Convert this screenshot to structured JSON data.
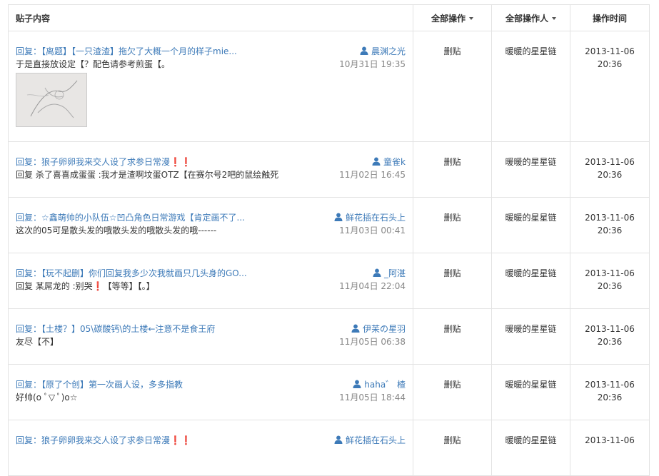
{
  "header": {
    "content": "贴子内容",
    "operation": "全部操作",
    "operator": "全部操作人",
    "time": "操作时间"
  },
  "rows": [
    {
      "title": "回复：【离题】【一只渣渣】拖欠了大概一个月的样子mie...",
      "text": "于是直接放设定【？配色请参考煎蛋【。",
      "author": "晨渊之光",
      "date": "10月31日 19:35",
      "operation": "删贴",
      "operator": "暖暖的星星链",
      "op_date": "2013-11-06",
      "op_time": "20:36",
      "has_image": true
    },
    {
      "title": "回复：狼子卵卵我来交人设了求参日常漫❗❗",
      "text": "回复 杀了喜喜成蛋蛋 :我才是渣啊坟蛋OTZ【在赛尔号2吧的鼠绘触死",
      "author": "童雀k",
      "date": "11月02日 16:45",
      "operation": "删贴",
      "operator": "暖暖的星星链",
      "op_date": "2013-11-06",
      "op_time": "20:36",
      "has_image": false
    },
    {
      "title": "回复：☆鑫萌帅的小队伍☆凹凸角色日常游戏【肯定画不了...",
      "text": "这次的05可是散头发的哦散头发的哦散头发的哦------",
      "author": "鲜花插在石头上",
      "date": "11月03日 00:41",
      "operation": "删贴",
      "operator": "暖暖的星星链",
      "op_date": "2013-11-06",
      "op_time": "20:36",
      "has_image": false
    },
    {
      "title": "回复：【玩不起删】你们回复我多少次我就画只几头身的GO...",
      "text": "回复 某屌龙的 :别哭❗【等等】【。】",
      "author": "_阿湛",
      "date": "11月04日 22:04",
      "operation": "删贴",
      "operator": "暖暖的星星链",
      "op_date": "2013-11-06",
      "op_time": "20:36",
      "has_image": false
    },
    {
      "title": "回复：【土楼？】05\\碳酸钙\\的土楼←注意不是食王府",
      "text": "友尽【不】",
      "author": "伊苿の星羽",
      "date": "11月05日 06:38",
      "operation": "删贴",
      "operator": "暖暖的星星链",
      "op_date": "2013-11-06",
      "op_time": "20:36",
      "has_image": false
    },
    {
      "title": "回复：【原了个创】第一次画人设，多多指教",
      "text": "好帅(o ﾟ▽ ﾟ)o☆",
      "author": "haha゛ 楂",
      "date": "11月05日 18:44",
      "operation": "删贴",
      "operator": "暖暖的星星链",
      "op_date": "2013-11-06",
      "op_time": "20:36",
      "has_image": false
    },
    {
      "title": "回复：狼子卵卵我来交人设了求参日常漫❗❗",
      "text": "",
      "author": "鲜花插在石头上",
      "date": "",
      "operation": "删贴",
      "operator": "暖暖的星星链",
      "op_date": "2013-11-06",
      "op_time": "",
      "has_image": false
    }
  ],
  "icons": {
    "author": "person-icon",
    "dropdown": "caret-down-icon"
  },
  "colors": {
    "link": "#3d7ab8",
    "border": "#e3e3e3",
    "muted": "#888888"
  }
}
